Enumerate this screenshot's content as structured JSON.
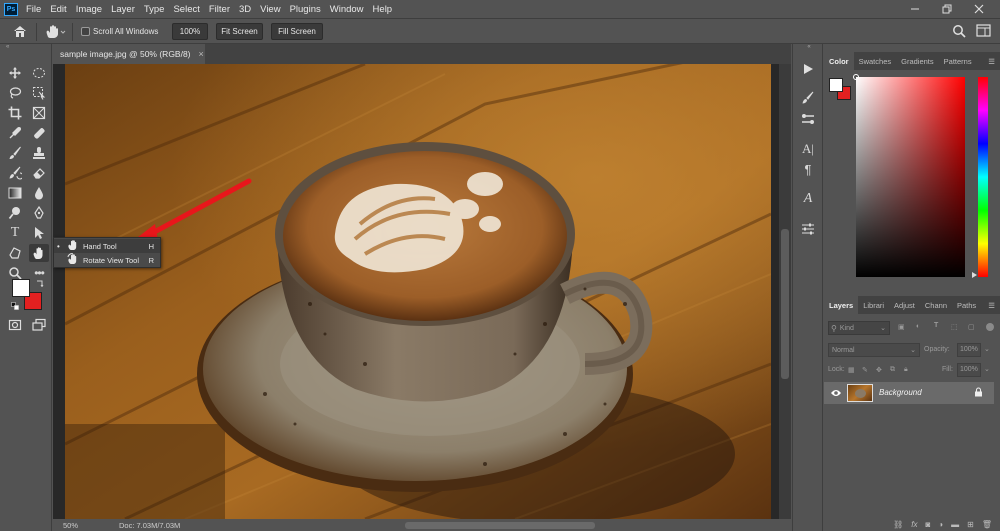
{
  "menubar": {
    "app_icon": "Ps",
    "items": [
      "File",
      "Edit",
      "Image",
      "Layer",
      "Type",
      "Select",
      "Filter",
      "3D",
      "View",
      "Plugins",
      "Window",
      "Help"
    ],
    "window_controls": [
      "minimize-icon",
      "restore-icon",
      "close-icon"
    ]
  },
  "options": {
    "scroll_all_windows": "Scroll All Windows",
    "zoom_100": "100%",
    "fit_screen": "Fit Screen",
    "fill_screen": "Fill Screen"
  },
  "document": {
    "tab_title": "sample image.jpg @ 50% (RGB/8)",
    "tab_close": "×",
    "zoom": "50%",
    "doc_info": "Doc: 7.03M/7.03M"
  },
  "flyout": {
    "items": [
      {
        "label": "Hand Tool",
        "shortcut": "H"
      },
      {
        "label": "Rotate View Tool",
        "shortcut": "R"
      }
    ]
  },
  "color_panel": {
    "tabs": [
      "Color",
      "Swatches",
      "Gradients",
      "Patterns"
    ]
  },
  "layers_panel": {
    "tabs": [
      "Layers",
      "Librari",
      "Adjust",
      "Chann",
      "Paths"
    ],
    "kind": "Kind",
    "blend_mode": "Normal",
    "opacity_label": "Opacity:",
    "opacity_value": "100%",
    "lock_label": "Lock:",
    "fill_label": "Fill:",
    "fill_value": "100%",
    "layers": [
      {
        "name": "Background"
      }
    ]
  },
  "colors": {
    "foreground": "#ffffff",
    "background": "#e32020",
    "annotation_arrow": "#e8161b"
  }
}
